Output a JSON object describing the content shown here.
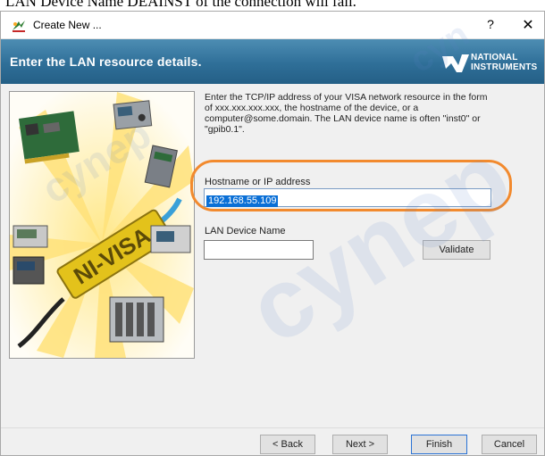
{
  "doc_caption": "LAN Device Name DEAINST of the connection will fail.",
  "window": {
    "title": "Create New ...",
    "help_glyph": "?",
    "close_glyph": "✕",
    "app_icon": "ni-max-icon"
  },
  "banner": {
    "heading": "Enter the LAN resource details.",
    "logo_line1": "NATIONAL",
    "logo_line2": "INSTRUMENTS",
    "background_color": "#2f6f98"
  },
  "illustration": {
    "label": "NI-VISA",
    "icon": "ni-visa-instruments-illustration"
  },
  "form": {
    "description": "Enter the TCP/IP address of your VISA network resource in the form of xxx.xxx.xxx.xxx, the hostname of the device, or a computer@some.domain. The LAN device name is often \"inst0\" or \"gpib0.1\".",
    "hostname_label": "Hostname or IP address",
    "hostname_value": "192.168.55.109",
    "lan_device_label": "LAN Device Name",
    "lan_device_value": "",
    "validate_label": "Validate",
    "highlight_color": "#f28a2e",
    "selection_color": "#0a6fd6"
  },
  "footer": {
    "back_label": "< Back",
    "next_label": "Next >",
    "finish_label": "Finish",
    "cancel_label": "Cancel"
  },
  "watermark": {
    "text_big": "cynep",
    "text_small1": "cynep",
    "text_small2": "cyn"
  }
}
